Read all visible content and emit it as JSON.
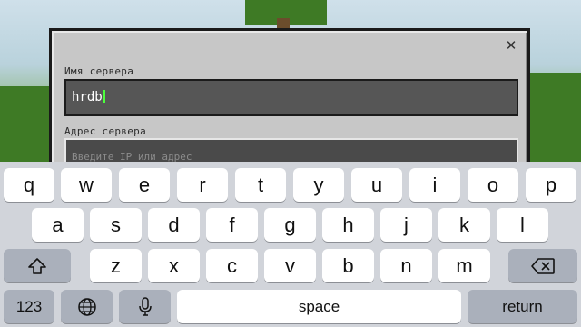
{
  "dialog": {
    "server_name_label": "Имя сервера",
    "server_name_value": "hrdb",
    "server_address_label": "Адрес сервера",
    "server_address_placeholder": "Введите IP или адрес",
    "close_icon": "close-icon"
  },
  "keyboard": {
    "row1": [
      "q",
      "w",
      "e",
      "r",
      "t",
      "y",
      "u",
      "i",
      "o",
      "p"
    ],
    "row2": [
      "a",
      "s",
      "d",
      "f",
      "g",
      "h",
      "j",
      "k",
      "l"
    ],
    "row3": [
      "z",
      "x",
      "c",
      "v",
      "b",
      "n",
      "m"
    ],
    "numbers_label": "123",
    "space_label": "space",
    "return_label": "return",
    "icons": [
      "shift-icon",
      "backspace-icon",
      "globe-icon",
      "microphone-icon"
    ]
  }
}
